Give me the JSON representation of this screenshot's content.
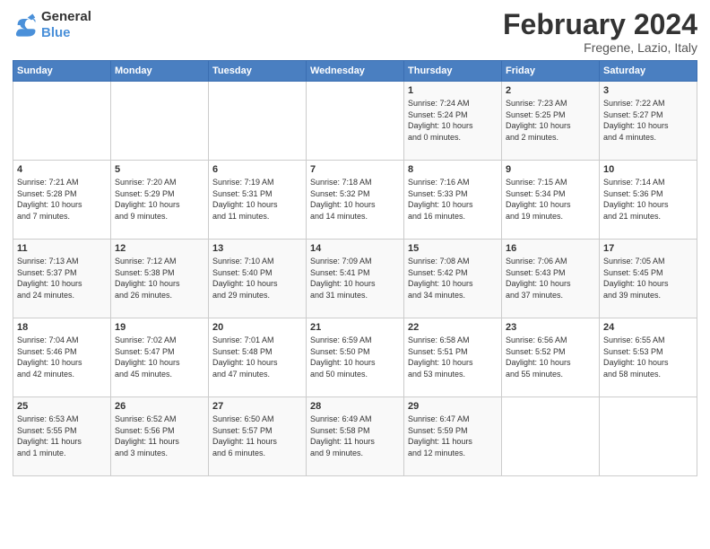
{
  "logo": {
    "line1": "General",
    "line2": "Blue"
  },
  "title": "February 2024",
  "subtitle": "Fregene, Lazio, Italy",
  "days_of_week": [
    "Sunday",
    "Monday",
    "Tuesday",
    "Wednesday",
    "Thursday",
    "Friday",
    "Saturday"
  ],
  "weeks": [
    [
      {
        "day": "",
        "info": ""
      },
      {
        "day": "",
        "info": ""
      },
      {
        "day": "",
        "info": ""
      },
      {
        "day": "",
        "info": ""
      },
      {
        "day": "1",
        "info": "Sunrise: 7:24 AM\nSunset: 5:24 PM\nDaylight: 10 hours\nand 0 minutes."
      },
      {
        "day": "2",
        "info": "Sunrise: 7:23 AM\nSunset: 5:25 PM\nDaylight: 10 hours\nand 2 minutes."
      },
      {
        "day": "3",
        "info": "Sunrise: 7:22 AM\nSunset: 5:27 PM\nDaylight: 10 hours\nand 4 minutes."
      }
    ],
    [
      {
        "day": "4",
        "info": "Sunrise: 7:21 AM\nSunset: 5:28 PM\nDaylight: 10 hours\nand 7 minutes."
      },
      {
        "day": "5",
        "info": "Sunrise: 7:20 AM\nSunset: 5:29 PM\nDaylight: 10 hours\nand 9 minutes."
      },
      {
        "day": "6",
        "info": "Sunrise: 7:19 AM\nSunset: 5:31 PM\nDaylight: 10 hours\nand 11 minutes."
      },
      {
        "day": "7",
        "info": "Sunrise: 7:18 AM\nSunset: 5:32 PM\nDaylight: 10 hours\nand 14 minutes."
      },
      {
        "day": "8",
        "info": "Sunrise: 7:16 AM\nSunset: 5:33 PM\nDaylight: 10 hours\nand 16 minutes."
      },
      {
        "day": "9",
        "info": "Sunrise: 7:15 AM\nSunset: 5:34 PM\nDaylight: 10 hours\nand 19 minutes."
      },
      {
        "day": "10",
        "info": "Sunrise: 7:14 AM\nSunset: 5:36 PM\nDaylight: 10 hours\nand 21 minutes."
      }
    ],
    [
      {
        "day": "11",
        "info": "Sunrise: 7:13 AM\nSunset: 5:37 PM\nDaylight: 10 hours\nand 24 minutes."
      },
      {
        "day": "12",
        "info": "Sunrise: 7:12 AM\nSunset: 5:38 PM\nDaylight: 10 hours\nand 26 minutes."
      },
      {
        "day": "13",
        "info": "Sunrise: 7:10 AM\nSunset: 5:40 PM\nDaylight: 10 hours\nand 29 minutes."
      },
      {
        "day": "14",
        "info": "Sunrise: 7:09 AM\nSunset: 5:41 PM\nDaylight: 10 hours\nand 31 minutes."
      },
      {
        "day": "15",
        "info": "Sunrise: 7:08 AM\nSunset: 5:42 PM\nDaylight: 10 hours\nand 34 minutes."
      },
      {
        "day": "16",
        "info": "Sunrise: 7:06 AM\nSunset: 5:43 PM\nDaylight: 10 hours\nand 37 minutes."
      },
      {
        "day": "17",
        "info": "Sunrise: 7:05 AM\nSunset: 5:45 PM\nDaylight: 10 hours\nand 39 minutes."
      }
    ],
    [
      {
        "day": "18",
        "info": "Sunrise: 7:04 AM\nSunset: 5:46 PM\nDaylight: 10 hours\nand 42 minutes."
      },
      {
        "day": "19",
        "info": "Sunrise: 7:02 AM\nSunset: 5:47 PM\nDaylight: 10 hours\nand 45 minutes."
      },
      {
        "day": "20",
        "info": "Sunrise: 7:01 AM\nSunset: 5:48 PM\nDaylight: 10 hours\nand 47 minutes."
      },
      {
        "day": "21",
        "info": "Sunrise: 6:59 AM\nSunset: 5:50 PM\nDaylight: 10 hours\nand 50 minutes."
      },
      {
        "day": "22",
        "info": "Sunrise: 6:58 AM\nSunset: 5:51 PM\nDaylight: 10 hours\nand 53 minutes."
      },
      {
        "day": "23",
        "info": "Sunrise: 6:56 AM\nSunset: 5:52 PM\nDaylight: 10 hours\nand 55 minutes."
      },
      {
        "day": "24",
        "info": "Sunrise: 6:55 AM\nSunset: 5:53 PM\nDaylight: 10 hours\nand 58 minutes."
      }
    ],
    [
      {
        "day": "25",
        "info": "Sunrise: 6:53 AM\nSunset: 5:55 PM\nDaylight: 11 hours\nand 1 minute."
      },
      {
        "day": "26",
        "info": "Sunrise: 6:52 AM\nSunset: 5:56 PM\nDaylight: 11 hours\nand 3 minutes."
      },
      {
        "day": "27",
        "info": "Sunrise: 6:50 AM\nSunset: 5:57 PM\nDaylight: 11 hours\nand 6 minutes."
      },
      {
        "day": "28",
        "info": "Sunrise: 6:49 AM\nSunset: 5:58 PM\nDaylight: 11 hours\nand 9 minutes."
      },
      {
        "day": "29",
        "info": "Sunrise: 6:47 AM\nSunset: 5:59 PM\nDaylight: 11 hours\nand 12 minutes."
      },
      {
        "day": "",
        "info": ""
      },
      {
        "day": "",
        "info": ""
      }
    ]
  ]
}
